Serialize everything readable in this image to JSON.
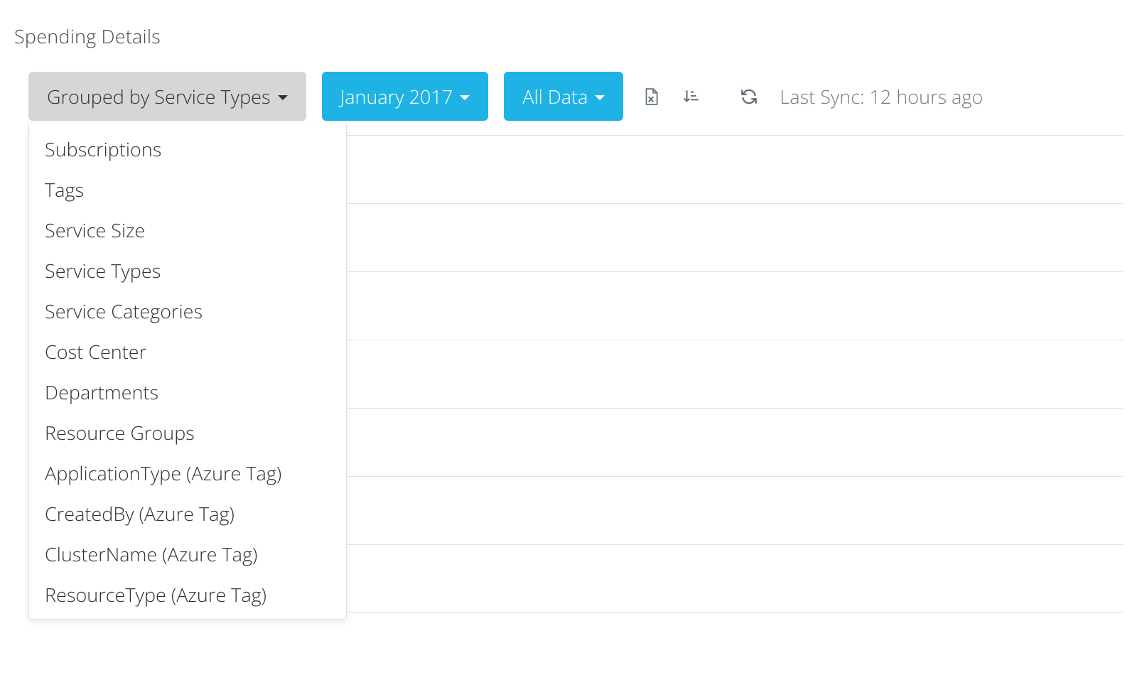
{
  "page": {
    "title": "Spending Details"
  },
  "toolbar": {
    "group_by": {
      "label": "Grouped by Service Types"
    },
    "period": {
      "label": "January 2017"
    },
    "scope": {
      "label": "All Data"
    },
    "sync": {
      "label": "Last Sync: 12 hours ago"
    },
    "icons": {
      "export": "export-excel-icon",
      "sort": "sort-amount-icon",
      "refresh": "refresh-icon"
    }
  },
  "group_by_menu": {
    "items": [
      "Subscriptions",
      "Tags",
      "Service Size",
      "Service Types",
      "Service Categories",
      "Cost Center",
      "Departments",
      "Resource Groups",
      "ApplicationType (Azure Tag)",
      "CreatedBy (Azure Tag)",
      "ClusterName (Azure Tag)",
      "ResourceType (Azure Tag)"
    ]
  },
  "rows": {
    "marker_colors": [
      "#d38b2b",
      "#333333",
      "#1fb3e5",
      "#333333",
      "#333333",
      "#333333",
      "#333333"
    ]
  }
}
